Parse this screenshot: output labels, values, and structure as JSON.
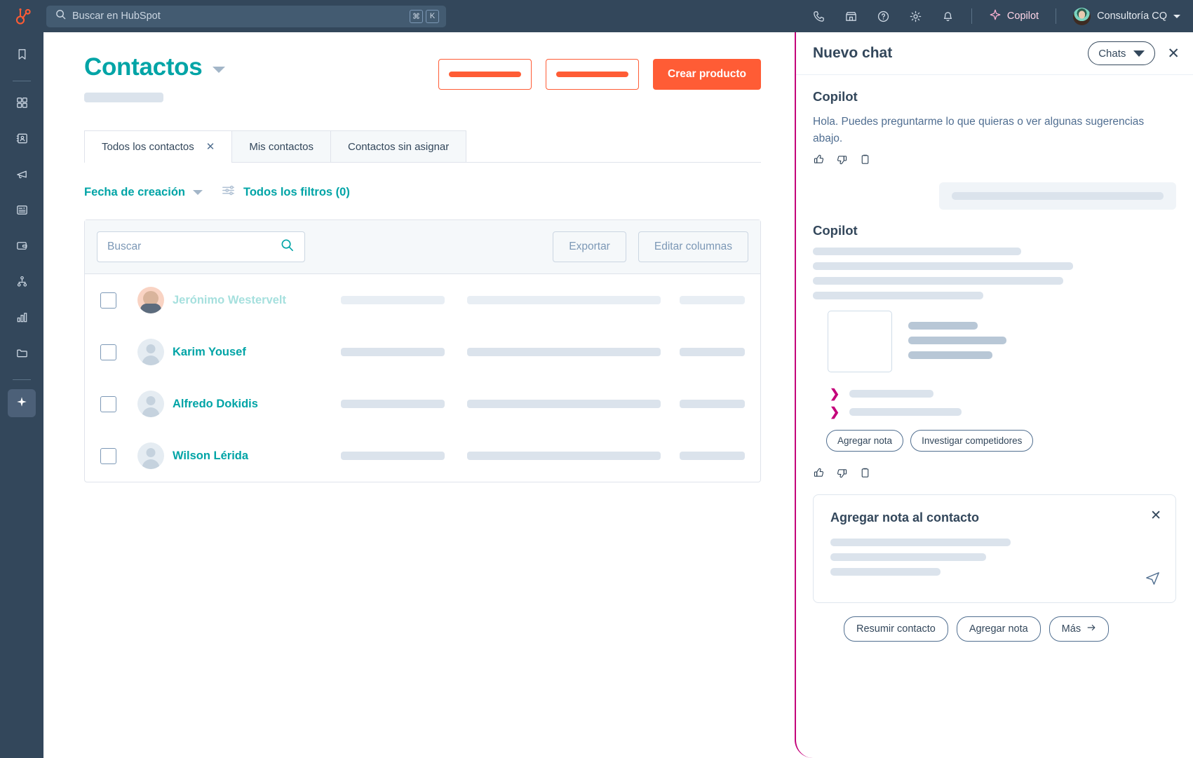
{
  "topbar": {
    "logo_icon": "hubspot-sprocket-icon",
    "search": {
      "placeholder": "Buscar en HubSpot",
      "icon": "search-icon",
      "kbd_modifier": "⌘",
      "kbd_key": "K"
    },
    "icons": [
      {
        "name": "phone-icon"
      },
      {
        "name": "marketplace-icon"
      },
      {
        "name": "help-circle-icon"
      },
      {
        "name": "settings-gear-icon"
      },
      {
        "name": "notifications-bell-icon"
      }
    ],
    "copilot_label": "Copilot",
    "copilot_icon": "sparkle-icon",
    "account_name": "Consultoría CQ",
    "account_caret_icon": "chevron-down-icon"
  },
  "rail": {
    "items": [
      {
        "icon": "bookmark-icon",
        "active": false
      },
      {
        "icon": "dashboard-grid-icon",
        "active": false
      },
      {
        "icon": "contacts-card-icon",
        "active": false
      },
      {
        "icon": "megaphone-icon",
        "active": false
      },
      {
        "icon": "content-page-icon",
        "active": false
      },
      {
        "icon": "commerce-wallet-icon",
        "active": false
      },
      {
        "icon": "automation-workflow-icon",
        "active": false
      },
      {
        "icon": "reports-bar-chart-icon",
        "active": false
      },
      {
        "icon": "library-folder-icon",
        "active": false
      },
      {
        "icon": "ai-sparkle-icon",
        "active": true
      }
    ]
  },
  "page": {
    "title": "Contactos",
    "title_caret_icon": "chevron-down-icon",
    "actions": {
      "outline_1_placeholder": "",
      "outline_2_placeholder": "",
      "primary_label": "Crear producto"
    },
    "tabs": [
      {
        "label": "Todos los contactos",
        "active": true,
        "closable": true,
        "close_icon": "close-icon"
      },
      {
        "label": "Mis contactos",
        "active": false,
        "closable": false
      },
      {
        "label": "Contactos sin asignar",
        "active": false,
        "closable": false
      }
    ],
    "filters": {
      "date_label": "Fecha de creación",
      "date_caret_icon": "chevron-down-icon",
      "all_filters_label": "Todos los filtros (0)",
      "all_filters_icon": "filter-sliders-icon"
    },
    "table": {
      "search_placeholder": "Buscar",
      "search_icon": "search-icon",
      "export_label": "Exportar",
      "edit_columns_label": "Editar columnas",
      "rows": [
        {
          "name": "Jerónimo Westervelt",
          "avatar": "photo",
          "faded": true,
          "checked": false
        },
        {
          "name": "Karim Yousef",
          "avatar": "generic",
          "faded": false,
          "checked": false
        },
        {
          "name": "Alfredo Dokidis",
          "avatar": "generic",
          "faded": false,
          "checked": false
        },
        {
          "name": "Wilson Lérida",
          "avatar": "generic",
          "faded": false,
          "checked": false
        }
      ]
    }
  },
  "panel": {
    "title": "Nuevo chat",
    "chats_label": "Chats",
    "chats_caret_icon": "chevron-down-icon",
    "close_icon": "close-icon",
    "accent_color": "#c4007a",
    "message_1": {
      "sender": "Copilot",
      "text": "Hola. Puedes preguntarme lo que quieras o ver algunas sugerencias abajo.",
      "feedback": [
        {
          "icon": "thumbs-up-icon"
        },
        {
          "icon": "thumbs-down-icon"
        },
        {
          "icon": "copy-clipboard-icon"
        }
      ]
    },
    "message_2": {
      "sender": "Copilot",
      "feedback": [
        {
          "icon": "thumbs-up-icon"
        },
        {
          "icon": "thumbs-down-icon"
        },
        {
          "icon": "copy-clipboard-icon"
        }
      ],
      "suggestion_chips": [
        {
          "label": "Agregar nota"
        },
        {
          "label": "Investigar competidores"
        }
      ],
      "chevron_icon": "chevron-right-icon"
    },
    "note_card": {
      "title": "Agregar nota al contacto",
      "close_icon": "close-icon",
      "send_icon": "send-paper-plane-icon"
    },
    "bottom_chips": [
      {
        "label": "Resumir contacto",
        "arrow": false
      },
      {
        "label": "Agregar nota",
        "arrow": false
      },
      {
        "label": "Más",
        "arrow": true,
        "arrow_icon": "arrow-right-icon"
      }
    ]
  },
  "colors": {
    "brand_orange": "#ff5c35",
    "teal": "#00a4a6",
    "navy": "#33475b",
    "magenta": "#c4007a"
  }
}
